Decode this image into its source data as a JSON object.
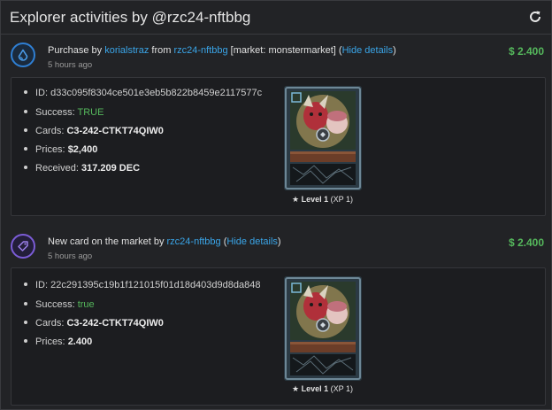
{
  "header": {
    "title": "Explorer activities by @rzc24-nftbbg",
    "refresh_icon": "refresh-icon"
  },
  "activities": [
    {
      "icon": "droplet-icon",
      "icon_color": "#2f7fd3",
      "action_prefix": "Purchase by ",
      "buyer": "korialstraz",
      "from_text": " from ",
      "seller": "rzc24-nftbbg",
      "market_text": " [market: monstermarket] (",
      "toggle_label": "Hide details",
      "close_paren": ")",
      "time": "5 hours ago",
      "amount": "$ 2.400",
      "details": {
        "id_label": "ID: ",
        "id_value": "d33c095f8304ce501e3eb5b822b8459e2117577c",
        "success_label": "Success: ",
        "success_value": "TRUE",
        "cards_label": "Cards: ",
        "cards_value": "C3-242-CTKT74QIW0",
        "prices_label": "Prices: ",
        "prices_value": "$2,400",
        "received_label": "Received: ",
        "received_value": "317.209 DEC"
      },
      "card": {
        "level_label": "Level 1",
        "xp": "(XP 1)"
      }
    },
    {
      "icon": "tag-icon",
      "icon_color": "#7b5cd6",
      "action_prefix": "New card on the market by ",
      "seller": "rzc24-nftbbg",
      "open_paren": " (",
      "toggle_label": "Hide details",
      "close_paren": ")",
      "time": "5 hours ago",
      "amount": "$ 2.400",
      "details": {
        "id_label": "ID: ",
        "id_value": "22c291395c19b1f121015f01d18d403d9d8da848",
        "success_label": "Success: ",
        "success_value": "true",
        "cards_label": "Cards: ",
        "cards_value": "C3-242-CTKT74QIW0",
        "prices_label": "Prices: ",
        "prices_value": "2.400"
      },
      "card": {
        "level_label": "Level 1",
        "xp": "(XP 1)"
      }
    }
  ]
}
